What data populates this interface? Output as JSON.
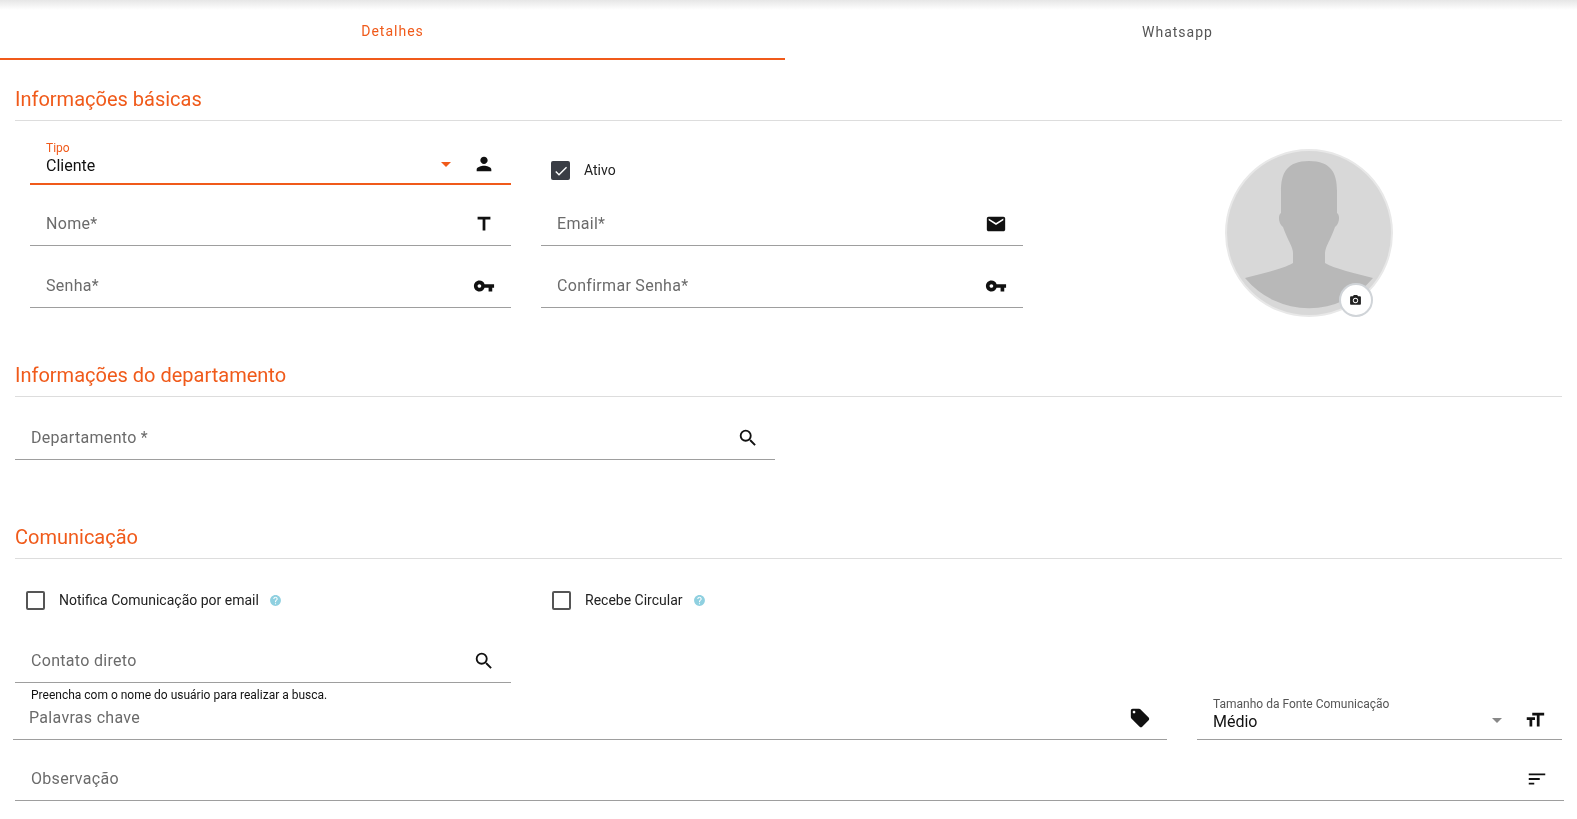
{
  "tabs": [
    {
      "label": "Detalhes",
      "selected": true
    },
    {
      "label": "Whatsapp",
      "selected": false
    }
  ],
  "basic": {
    "title": "Informações básicas",
    "tipo": {
      "label": "Tipo",
      "value": "Cliente",
      "focused": true
    },
    "ativo": {
      "label": "Ativo",
      "checked": true
    },
    "nome": {
      "placeholder": "Nome*"
    },
    "email": {
      "placeholder": "Email*"
    },
    "senha": {
      "placeholder": "Senha*"
    },
    "confirmar": {
      "placeholder": "Confirmar Senha*"
    }
  },
  "department": {
    "title": "Informações do departamento",
    "field": {
      "placeholder": "Departamento *"
    }
  },
  "communication": {
    "title": "Comunicação",
    "checkboxes": [
      {
        "label": "Notifica Comunicação por email",
        "checked": false
      },
      {
        "label": "Recebe Circular",
        "checked": false
      }
    ],
    "contato": {
      "placeholder": "Contato direto",
      "hint": "Preencha com o nome do usuário para realizar a busca."
    },
    "palavras": {
      "placeholder": "Palavras chave"
    },
    "fonte": {
      "label": "Tamanho da Fonte Comunicação",
      "value": "Médio",
      "focused": false
    },
    "observacao": {
      "placeholder": "Observação"
    }
  }
}
